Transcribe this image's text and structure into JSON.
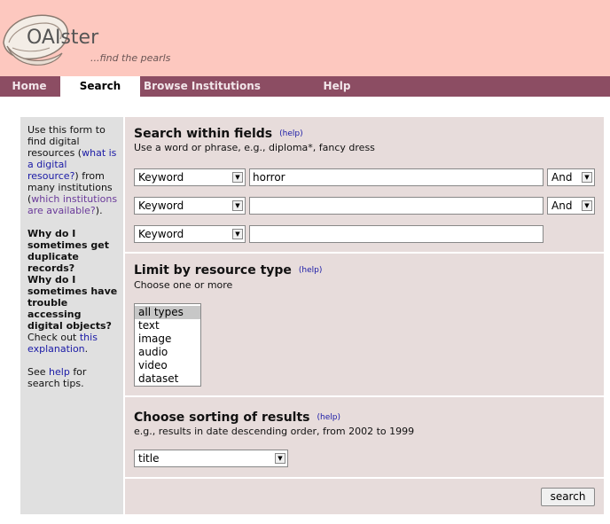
{
  "header": {
    "logo_title": "OAIster",
    "tagline": "...find the pearls"
  },
  "nav": {
    "items": [
      {
        "label": "Home",
        "active": false
      },
      {
        "label": "Search",
        "active": true
      },
      {
        "label": "Browse Institutions",
        "active": false
      },
      {
        "label": "Help",
        "active": false
      }
    ]
  },
  "sidebar": {
    "intro_1": "Use this form to find digital resources (",
    "link_what": "what is a digital resource?",
    "intro_2": ") from many institutions (",
    "link_which": "which institutions are available?",
    "intro_3": ").",
    "q1": "Why do I sometimes get duplicate records?",
    "q2": "Why do I sometimes have trouble accessing digital objects?",
    "checkout": "Check out",
    "link_this": "this explanation",
    "period": ".",
    "see": "See",
    "link_help": "help",
    "tips": "for search tips."
  },
  "fields": {
    "title": "Search within fields",
    "help": "(help)",
    "subtitle": "Use a word or phrase, e.g., diploma*, fancy dress",
    "rows": [
      {
        "field": "Keyword",
        "value": "horror",
        "operator": "And"
      },
      {
        "field": "Keyword",
        "value": "",
        "operator": "And"
      },
      {
        "field": "Keyword",
        "value": ""
      }
    ]
  },
  "resource": {
    "title": "Limit by resource type",
    "help": "(help)",
    "subtitle": "Choose one or more",
    "options": [
      "all types",
      "text",
      "image",
      "audio",
      "video",
      "dataset"
    ],
    "selected": "all types"
  },
  "sorting": {
    "title": "Choose sorting of results",
    "help": "(help)",
    "subtitle": "e.g., results in date descending order, from 2002 to 1999",
    "value": "title"
  },
  "search_button": "search"
}
